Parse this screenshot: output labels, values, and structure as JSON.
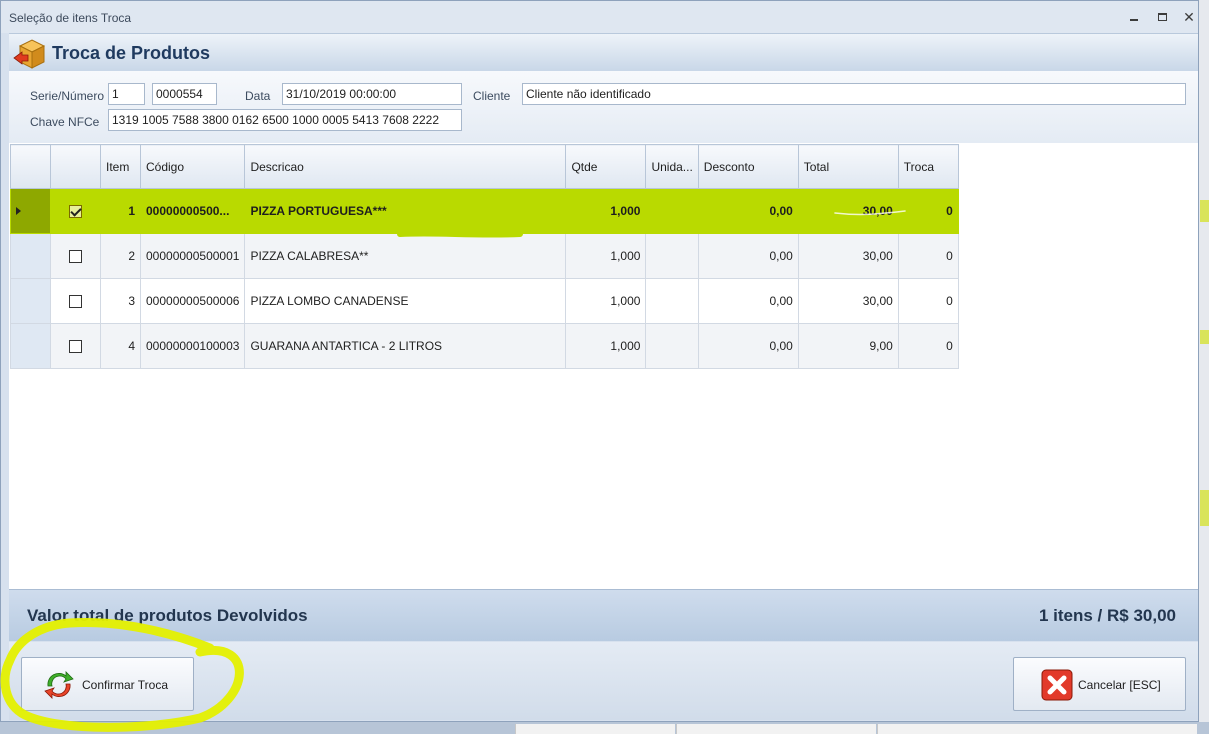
{
  "window": {
    "title": "Seleção de itens Troca"
  },
  "header": {
    "title": "Troca de Produtos",
    "icon": "box-exchange-icon"
  },
  "form": {
    "serie_label": "Serie/Número",
    "serie_value": "1",
    "numero_value": "0000554",
    "data_label": "Data",
    "data_value": "31/10/2019 00:00:00",
    "cliente_label": "Cliente",
    "cliente_value": "Cliente não identificado",
    "chave_label": "Chave NFCe",
    "chave_value": "1319 1005 7588 3800 0162 6500 1000 0005 5413 7608 2222"
  },
  "grid": {
    "columns": [
      "",
      "",
      "Item",
      "Código",
      "Descricao",
      "Qtde",
      "Unida...",
      "Desconto",
      "Total",
      "Troca"
    ],
    "rows": [
      {
        "checked": true,
        "item": "1",
        "codigo": "00000000500...",
        "descricao": "PIZZA PORTUGUESA***",
        "qtde": "1,000",
        "unidade": "",
        "desconto": "0,00",
        "total": "30,00",
        "troca": "0"
      },
      {
        "checked": false,
        "item": "2",
        "codigo": "00000000500001",
        "descricao": "PIZZA CALABRESA**",
        "qtde": "1,000",
        "unidade": "",
        "desconto": "0,00",
        "total": "30,00",
        "troca": "0"
      },
      {
        "checked": false,
        "item": "3",
        "codigo": "00000000500006",
        "descricao": "PIZZA LOMBO CANADENSE",
        "qtde": "1,000",
        "unidade": "",
        "desconto": "0,00",
        "total": "30,00",
        "troca": "0"
      },
      {
        "checked": false,
        "item": "4",
        "codigo": "00000000100003",
        "descricao": "GUARANA ANTARTICA - 2 LITROS",
        "qtde": "1,000",
        "unidade": "",
        "desconto": "0,00",
        "total": "9,00",
        "troca": "0"
      }
    ]
  },
  "summary": {
    "label": "Valor total de produtos Devolvidos",
    "value": "1 itens / R$ 30,00"
  },
  "buttons": {
    "confirm_label": "Confirmar Troca",
    "cancel_label": "Cancelar [ESC]"
  },
  "colors": {
    "highlight": "#b9da00",
    "accent": "#1f3a5f"
  }
}
